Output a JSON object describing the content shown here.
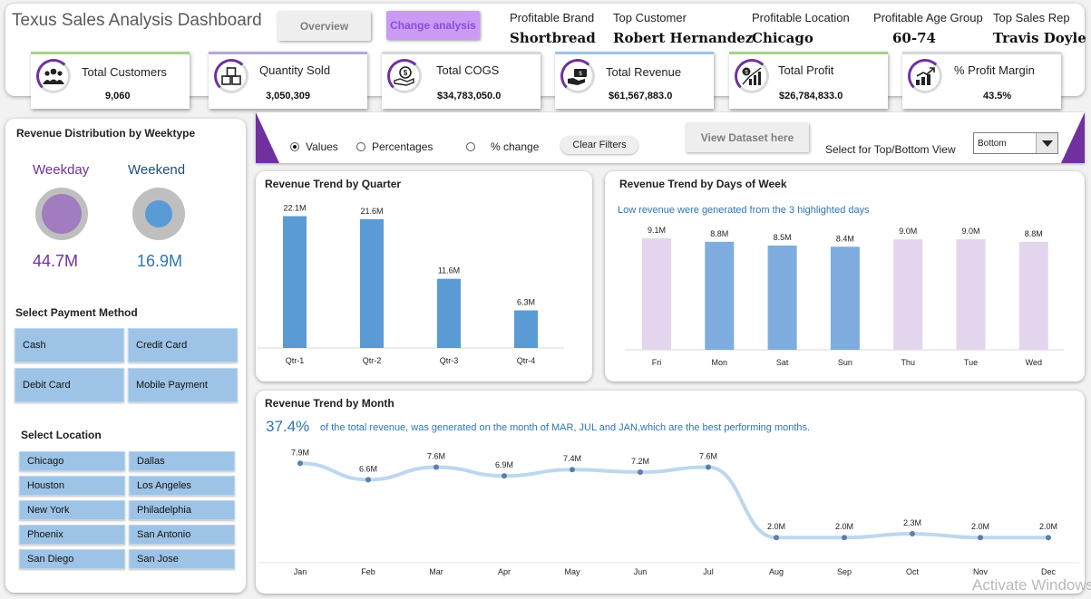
{
  "header": {
    "title": "Texus Sales Analysis Dashboard",
    "overview_label": "Overview",
    "change_label": "Change analysis",
    "info": [
      {
        "label": "Profitable Brand",
        "value": "Shortbread"
      },
      {
        "label": "Top Customer",
        "value": "Robert Hernandez"
      },
      {
        "label": "Profitable Location",
        "value": "Chicago"
      },
      {
        "label": "Profitable Age Group",
        "value": "60-74"
      },
      {
        "label": "Top Sales Rep",
        "value": "Travis Doyle"
      }
    ]
  },
  "kpis": [
    {
      "title": "Total Customers",
      "value": "9,060",
      "icon": "people-icon",
      "accent": "#a9d08e"
    },
    {
      "title": "Quantity Sold",
      "value": "3,050,309",
      "icon": "boxes-icon",
      "accent": "#b4a7d6"
    },
    {
      "title": "Total COGS",
      "value": "$34,783,050.0",
      "icon": "money-hand-icon",
      "accent": "#d9d9d9"
    },
    {
      "title": "Total Revenue",
      "value": "$61,567,883.0",
      "icon": "revenue-icon",
      "accent": "#9dc3e6"
    },
    {
      "title": "Total Profit",
      "value": "$26,784,833.0",
      "icon": "profit-chart-icon",
      "accent": "#a9d08e"
    },
    {
      "title": "% Profit Margin",
      "value": "43.5%",
      "icon": "growth-chart-icon",
      "accent": "#d9d9d9"
    }
  ],
  "weektype": {
    "title": "Revenue Distribution by Weektype",
    "weekday_label": "Weekday",
    "weekday_value": "44.7M",
    "weekday_color": "#7030a0",
    "weekend_label": "Weekend",
    "weekend_value": "16.9M",
    "weekend_color": "#2e75b6"
  },
  "payment": {
    "title": "Select Payment Method",
    "items": [
      "Cash",
      "Credit Card",
      "Debit Card",
      "Mobile Payment"
    ]
  },
  "location": {
    "title": "Select Location",
    "items": [
      "Chicago",
      "Dallas",
      "Houston",
      "Los Angeles",
      "New York",
      "Philadelphia",
      "Phoenix",
      "San Antonio",
      "San Diego",
      "San Jose"
    ]
  },
  "controls": {
    "radio_values": "Values",
    "radio_percentages": "Percentages",
    "radio_change": "% change",
    "selected": "Values",
    "clear_filters": "Clear Filters",
    "view_dataset": "View Dataset here",
    "topbottom_label": "Select for Top/Bottom View",
    "topbottom_value": "Bottom"
  },
  "quarter": {
    "title": "Revenue Trend by Quarter"
  },
  "days": {
    "title": "Revenue Trend by Days of Week",
    "subtitle": "Low revenue were generated from the 3 highlighted days"
  },
  "month": {
    "title": "Revenue Trend by Month",
    "highlight": "37.4%",
    "subtitle": "of the total revenue, was generated on the month of MAR, JUL and JAN,which are the best performing months."
  },
  "watermark": "Activate Windows",
  "chart_data": [
    {
      "type": "bar",
      "categories": [
        "Qtr-1",
        "Qtr-2",
        "Qtr-3",
        "Qtr-4"
      ],
      "values": [
        22.1,
        21.6,
        11.6,
        6.3
      ],
      "labels": [
        "22.1M",
        "21.6M",
        "11.6M",
        "6.3M"
      ],
      "color": "#5b9bd5",
      "ylim": [
        0,
        24
      ]
    },
    {
      "type": "bar",
      "categories": [
        "Fri",
        "Mon",
        "Sat",
        "Sun",
        "Thu",
        "Tue",
        "Wed"
      ],
      "values": [
        9.1,
        8.8,
        8.5,
        8.4,
        9.0,
        9.0,
        8.8
      ],
      "labels": [
        "9.1M",
        "8.8M",
        "8.5M",
        "8.4M",
        "9.0M",
        "9.0M",
        "8.8M"
      ],
      "highlighted": [
        false,
        true,
        true,
        true,
        false,
        false,
        false
      ],
      "highlight_color": "#7facdf",
      "base_color": "#e4d5ee",
      "ylim": [
        0,
        9.6
      ]
    },
    {
      "type": "line",
      "categories": [
        "Jan",
        "Feb",
        "Mar",
        "Apr",
        "May",
        "Jun",
        "Jul",
        "Aug",
        "Sep",
        "Oct",
        "Nov",
        "Dec"
      ],
      "values": [
        7.9,
        6.6,
        7.6,
        6.9,
        7.4,
        7.2,
        7.6,
        2.0,
        2.0,
        2.3,
        2.0,
        2.0
      ],
      "labels": [
        "7.9M",
        "6.6M",
        "7.6M",
        "6.9M",
        "7.4M",
        "7.2M",
        "7.6M",
        "2.0M",
        "2.0M",
        "2.3M",
        "2.0M",
        "2.0M"
      ],
      "line_color": "#bdd7ee",
      "marker_color": "#5a7fa8",
      "ylim": [
        0,
        9
      ]
    }
  ]
}
